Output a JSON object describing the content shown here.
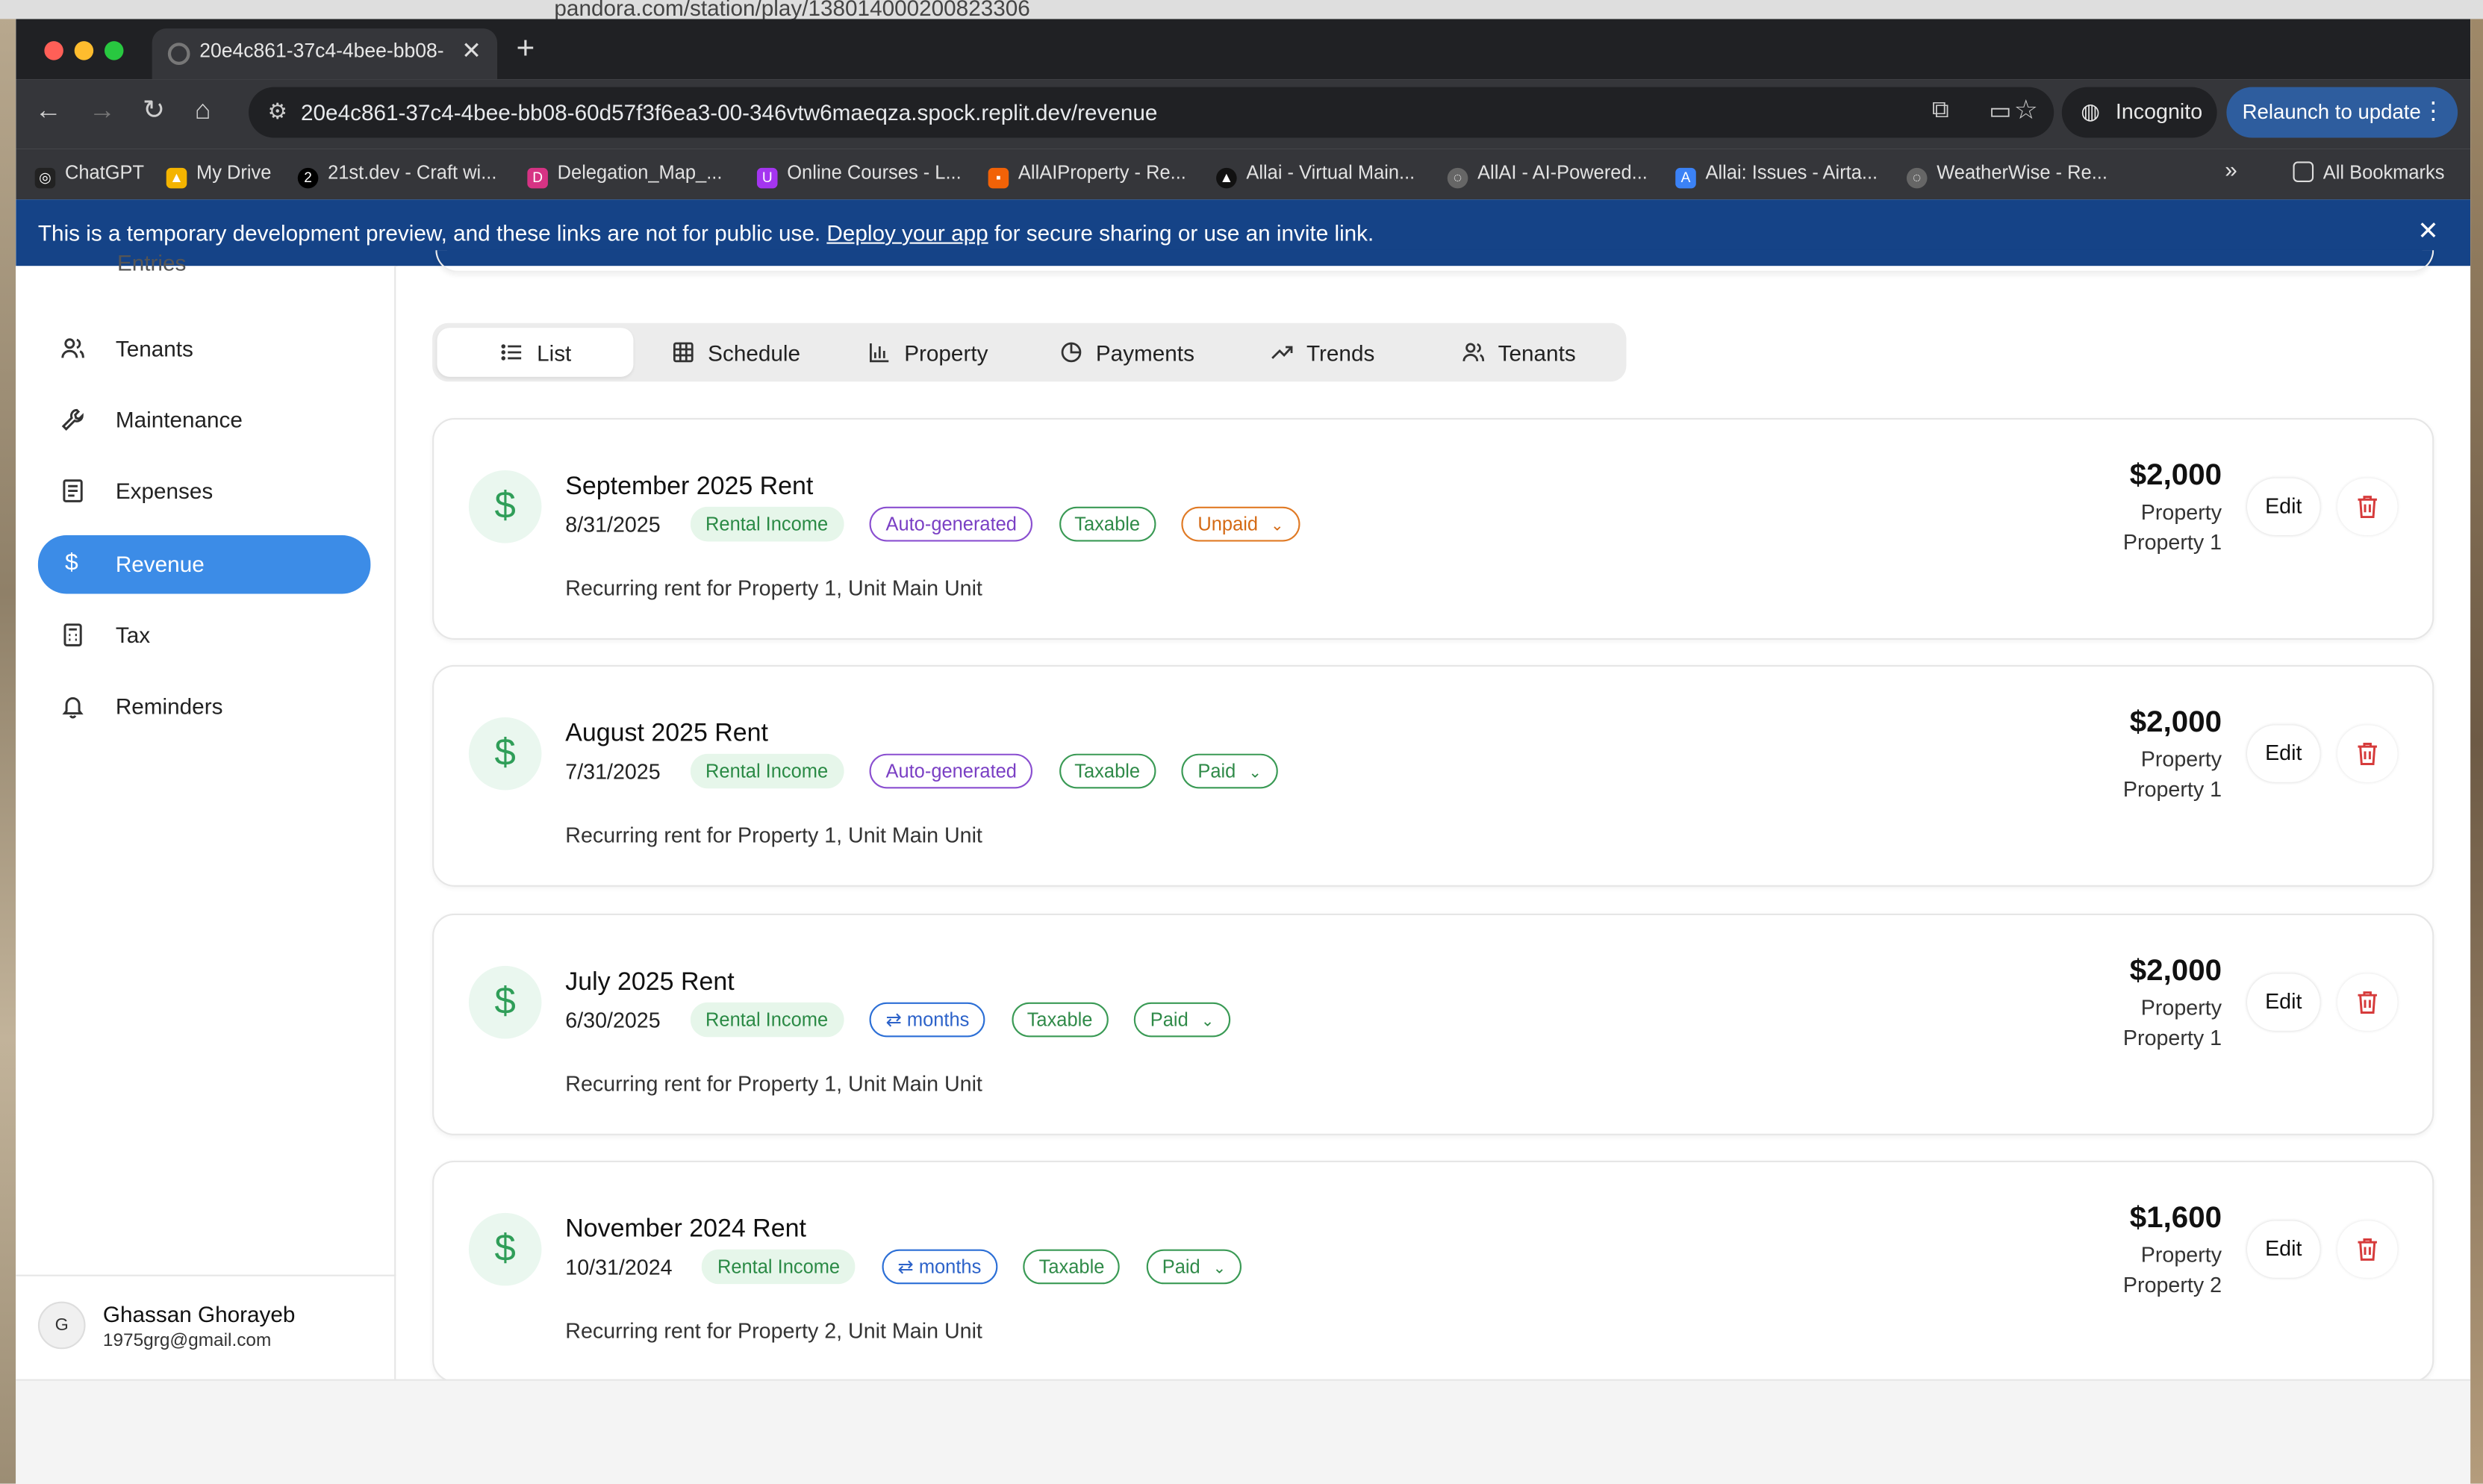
{
  "background_window": {
    "url": "pandora.com/station/play/138014000200823306",
    "relaunch_label": "Relaunch to up"
  },
  "browser": {
    "tab_title": "20e4c861-37c4-4bee-bb08-",
    "url": "20e4c861-37c4-4bee-bb08-60d57f3f6ea3-00-346vtw6maeqza.spock.replit.dev/revenue",
    "incognito_label": "Incognito",
    "relaunch_label": "Relaunch to update",
    "bookmarks": [
      {
        "label": "ChatGPT",
        "icon": "chatgpt-icon",
        "color": "#222222"
      },
      {
        "label": "My Drive",
        "icon": "google-drive-icon",
        "color": "#f4b400"
      },
      {
        "label": "21st.dev - Craft wi...",
        "icon": "21st-icon",
        "color": "#000000"
      },
      {
        "label": "Delegation_Map_...",
        "icon": "de-icon",
        "color": "#d63384"
      },
      {
        "label": "Online Courses - L...",
        "icon": "udemy-icon",
        "color": "#a435f0"
      },
      {
        "label": "AllAIProperty - Re...",
        "icon": "replit-icon",
        "color": "#f26207"
      },
      {
        "label": "Allai - Virtual Main...",
        "icon": "allai-icon",
        "color": "#111111"
      },
      {
        "label": "AllAI - AI-Powered...",
        "icon": "globe-icon",
        "color": "#666666"
      },
      {
        "label": "Allai: Issues - Airta...",
        "icon": "ai-icon",
        "color": "#3b82f6"
      },
      {
        "label": "WeatherWise - Re...",
        "icon": "globe-icon",
        "color": "#666666"
      }
    ],
    "all_bookmarks_label": "All Bookmarks"
  },
  "banner": {
    "text_before": "This is a temporary development preview, and these links are not for public use. ",
    "link": "Deploy your app",
    "text_after": " for secure sharing or use an invite link."
  },
  "sidebar": {
    "cut_item": "Entries",
    "items": [
      {
        "label": "Tenants",
        "icon": "users-icon",
        "active": false
      },
      {
        "label": "Maintenance",
        "icon": "wrench-icon",
        "active": false
      },
      {
        "label": "Expenses",
        "icon": "receipt-icon",
        "active": false
      },
      {
        "label": "Revenue",
        "icon": "dollar-icon",
        "active": true
      },
      {
        "label": "Tax",
        "icon": "calculator-icon",
        "active": false
      },
      {
        "label": "Reminders",
        "icon": "bell-icon",
        "active": false
      }
    ],
    "profile": {
      "initial": "G",
      "name": "Ghassan Ghorayeb",
      "email": "1975grg@gmail.com"
    }
  },
  "view_tabs": [
    {
      "label": "List",
      "icon": "list-icon",
      "active": true
    },
    {
      "label": "Schedule",
      "icon": "grid-icon",
      "active": false
    },
    {
      "label": "Property",
      "icon": "bar-chart-icon",
      "active": false
    },
    {
      "label": "Payments",
      "icon": "pie-chart-icon",
      "active": false
    },
    {
      "label": "Trends",
      "icon": "trending-up-icon",
      "active": false
    },
    {
      "label": "Tenants",
      "icon": "users-icon",
      "active": false
    }
  ],
  "revenue_items": [
    {
      "title": "September 2025 Rent",
      "date": "8/31/2025",
      "category": "Rental Income",
      "source": "Auto-generated",
      "taxable": "Taxable",
      "status": "Unpaid",
      "description": "Recurring rent for Property 1, Unit Main Unit",
      "amount": "$2,000",
      "property_line1": "Property",
      "property_line2": "Property 1",
      "edit_label": "Edit"
    },
    {
      "title": "August 2025 Rent",
      "date": "7/31/2025",
      "category": "Rental Income",
      "source": "Auto-generated",
      "taxable": "Taxable",
      "status": "Paid",
      "description": "Recurring rent for Property 1, Unit Main Unit",
      "amount": "$2,000",
      "property_line1": "Property",
      "property_line2": "Property 1",
      "edit_label": "Edit"
    },
    {
      "title": "July 2025 Rent",
      "date": "6/30/2025",
      "category": "Rental Income",
      "source": "months",
      "taxable": "Taxable",
      "status": "Paid",
      "description": "Recurring rent for Property 1, Unit Main Unit",
      "amount": "$2,000",
      "property_line1": "Property",
      "property_line2": "Property 1",
      "edit_label": "Edit"
    },
    {
      "title": "November 2024 Rent",
      "date": "10/31/2024",
      "category": "Rental Income",
      "source": "months",
      "taxable": "Taxable",
      "status": "Paid",
      "description": "Recurring rent for Property 2, Unit Main Unit",
      "amount": "$1,600",
      "property_line1": "Property",
      "property_line2": "Property 2",
      "edit_label": "Edit"
    }
  ],
  "colors": {
    "accent": "#3c8ce7",
    "banner": "#154387",
    "income_green": "#2f9e58",
    "unpaid_orange": "#d46a15",
    "auto_purple": "#7a3fc4",
    "recurring_blue": "#2c62c9",
    "delete_red": "#d63b3b"
  }
}
